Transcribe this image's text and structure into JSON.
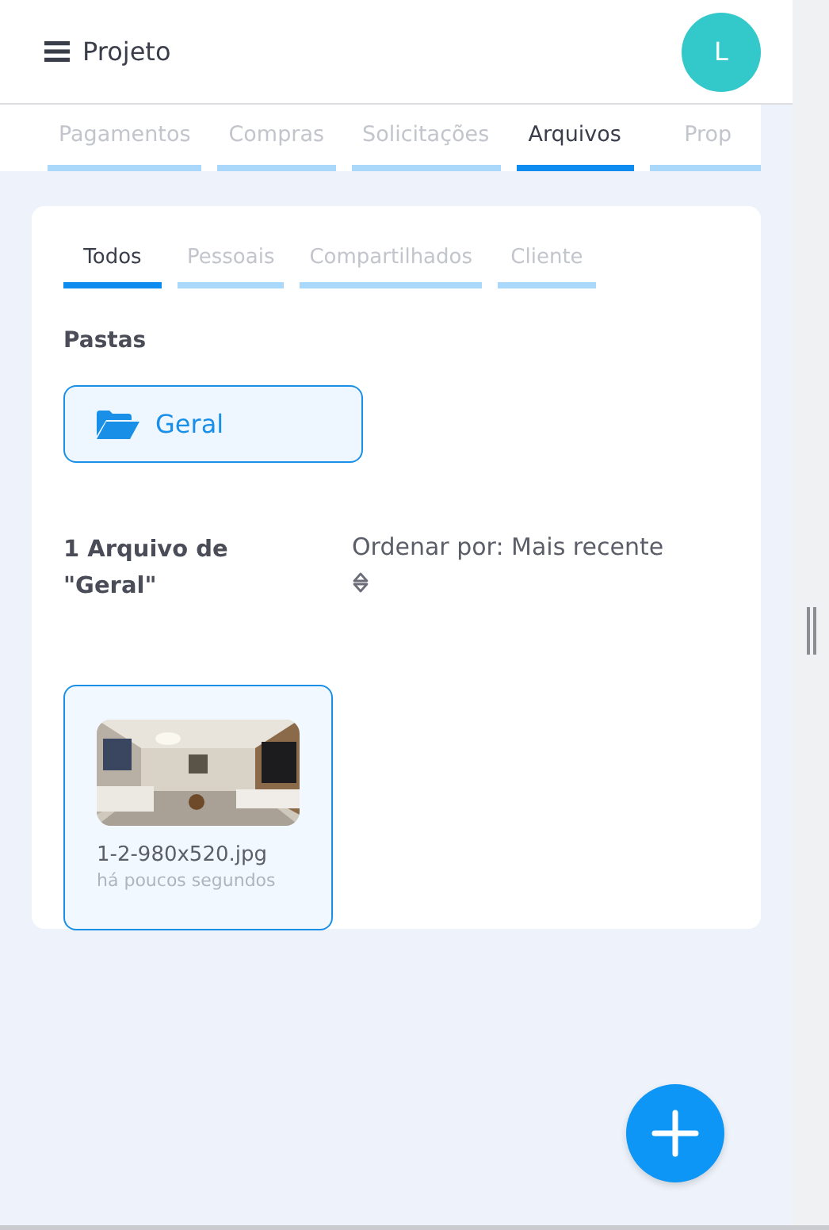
{
  "header": {
    "title": "Projeto",
    "avatar": "L"
  },
  "tabs": [
    {
      "label": "Pagamentos",
      "selected": false
    },
    {
      "label": "Compras",
      "selected": false
    },
    {
      "label": "Solicitações",
      "selected": false
    },
    {
      "label": "Arquivos",
      "selected": true
    },
    {
      "label": "Prop",
      "selected": false
    }
  ],
  "file_tabs": [
    {
      "label": "Todos",
      "selected": true
    },
    {
      "label": "Pessoais",
      "selected": false
    },
    {
      "label": "Compartilhados",
      "selected": false
    },
    {
      "label": "Cliente",
      "selected": false
    }
  ],
  "folders_heading": "Pastas",
  "folders": [
    {
      "name": "Geral",
      "selected": true
    }
  ],
  "file_count": "1 Arquivo de \"Geral\"",
  "sort_label": "Ordenar por: Mais recente",
  "files": [
    {
      "name": "1-2-980x520.jpg",
      "time": "há poucos segundos",
      "kind": "picture"
    }
  ]
}
